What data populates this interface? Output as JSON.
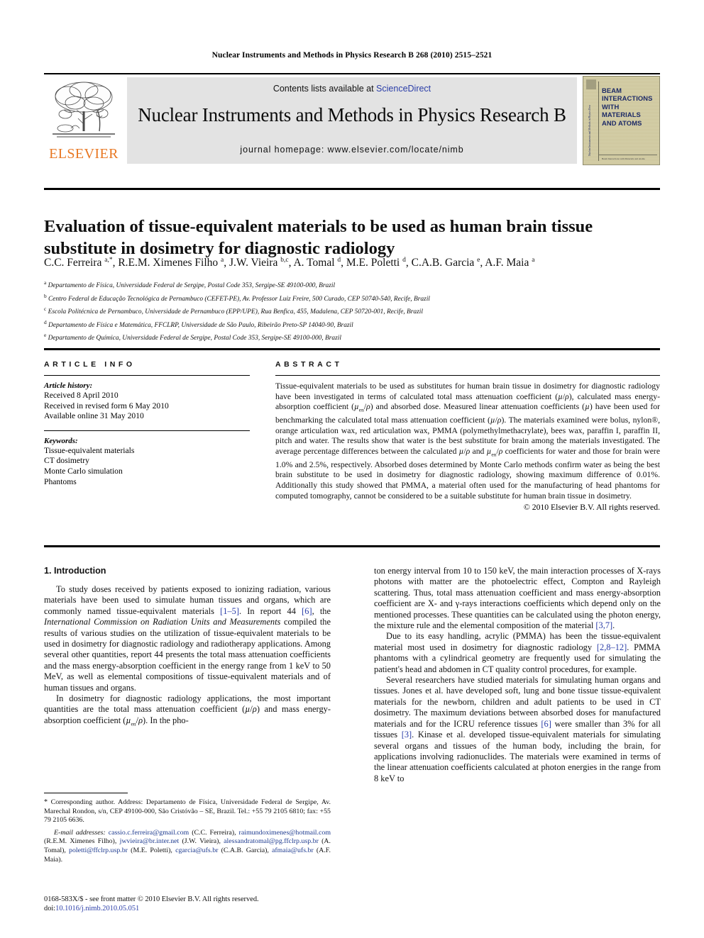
{
  "running_head": "Nuclear Instruments and Methods in Physics Research B 268 (2010) 2515–2521",
  "masthead": {
    "contents_prefix": "Contents lists available at ",
    "contents_link": "ScienceDirect",
    "journal_title": "Nuclear Instruments and Methods in Physics Research B",
    "homepage": "journal homepage: www.elsevier.com/locate/nimb",
    "publisher_logo_text": "ELSEVIER",
    "cover": {
      "title_lines": [
        "BEAM",
        "INTERACTIONS",
        "WITH",
        "MATERIALS",
        "AND ATOMS"
      ],
      "spine_text": "Nuclear Instruments and Methods in Physics Research B",
      "foot_text": "Beam Interactions with Materials and Atoms"
    }
  },
  "article": {
    "title": "Evaluation of tissue-equivalent materials to be used as human brain tissue substitute in dosimetry for diagnostic radiology",
    "authors_html": "C.C. Ferreira <sup>a,*</sup>, R.E.M. Ximenes Filho <sup>a</sup>, J.W. Vieira <sup>b,c</sup>, A. Tomal <sup>d</sup>, M.E. Poletti <sup>d</sup>, C.A.B. Garcia <sup>e</sup>, A.F. Maia <sup>a</sup>",
    "affiliations": [
      {
        "mark": "a",
        "text": "Departamento de Física, Universidade Federal de Sergipe, Postal Code 353, Sergipe-SE 49100-000, Brazil"
      },
      {
        "mark": "b",
        "text": "Centro Federal de Educação Tecnológica de Pernambuco (CEFET-PE), Av. Professor Luiz Freire, 500 Curado, CEP 50740-540, Recife, Brazil"
      },
      {
        "mark": "c",
        "text": "Escola Politécnica de Pernambuco, Universidade de Pernambuco (EPP/UPE), Rua Benfica, 455, Madalena, CEP 50720-001, Recife, Brazil"
      },
      {
        "mark": "d",
        "text": "Departamento de Física e Matemática, FFCLRP, Universidade de São Paulo, Ribeirão Preto-SP 14040-90, Brazil"
      },
      {
        "mark": "e",
        "text": "Departamento de Química, Universidade Federal de Sergipe, Postal Code 353, Sergipe-SE 49100-000, Brazil"
      }
    ]
  },
  "article_info": {
    "label": "ARTICLE INFO",
    "history_heading": "Article history:",
    "history": [
      "Received 8 April 2010",
      "Received in revised form 6 May 2010",
      "Available online 31 May 2010"
    ],
    "keywords_heading": "Keywords:",
    "keywords": [
      "Tissue-equivalent materials",
      "CT dosimetry",
      "Monte Carlo simulation",
      "Phantoms"
    ]
  },
  "abstract": {
    "label": "ABSTRACT",
    "html": "Tissue-equivalent materials to be used as substitutes for human brain tissue in dosimetry for diagnostic radiology have been investigated in terms of calculated total mass attenuation coefficient (<span class=\"ital\">µ</span>/<span class=\"ital\">ρ</span>), calculated mass energy-absorption coefficient (<span class=\"ital\">µ</span><sub>en</sub>/<span class=\"ital\">ρ</span>) and absorbed dose. Measured linear attenuation coefficients (<span class=\"ital\">µ</span>) have been used for benchmarking the calculated total mass attenuation coefficient (<span class=\"ital\">µ</span>/<span class=\"ital\">ρ</span>). The materials examined were bolus, nylon®, orange articulation wax, red articulation wax, PMMA (polymethylmethacrylate), bees wax, paraffin I, paraffin II, pitch and water. The results show that water is the best substitute for brain among the materials investigated. The average percentage differences between the calculated <span class=\"ital\">µ</span>/<span class=\"ital\">ρ</span> and <span class=\"ital\">µ</span><sub>en</sub>/<span class=\"ital\">ρ</span> coefficients for water and those for brain were 1.0% and 2.5%, respectively. Absorbed doses determined by Monte Carlo methods confirm water as being the best brain substitute to be used in dosimetry for diagnostic radiology, showing maximum difference of 0.01%. Additionally this study showed that PMMA, a material often used for the manufacturing of head phantoms for computed tomography, cannot be considered to be a suitable substitute for human brain tissue in dosimetry.",
    "copyright": "© 2010 Elsevier B.V. All rights reserved."
  },
  "body": {
    "section_heading": "1. Introduction",
    "left_paragraphs_html": [
      "To study doses received by patients exposed to ionizing radiation, various materials have been used to simulate human tissues and organs, which are commonly named tissue-equivalent materials <span class=\"ref\">[1–5]</span>. In report 44 <span class=\"ref\">[6]</span>, the <span class=\"ital\">International Commission on Radiation Units and Measurements</span> compiled the results of various studies on the utilization of tissue-equivalent materials to be used in dosimetry for diagnostic radiology and radiotherapy applications. Among several other quantities, report 44 presents the total mass attenuation coefficients and the mass energy-absorption coefficient in the energy range from 1 keV to 50 MeV, as well as elemental compositions of tissue-equivalent materials and of human tissues and organs.",
      "In dosimetry for diagnostic radiology applications, the most important quantities are the total mass attenuation coefficient (<span class=\"ital\">µ</span>/<span class=\"ital\">ρ</span>) and mass energy-absorption coefficient (<span class=\"ital\">µ</span><sub>en</sub>/<span class=\"ital\">ρ</span>). In the pho-"
    ],
    "right_paragraphs_html": [
      "ton energy interval from 10 to 150 keV, the main interaction processes of X-rays photons with matter are the photoelectric effect, Compton and Rayleigh scattering. Thus, total mass attenuation coefficient and mass energy-absorption coefficient are X- and γ-rays interactions coefficients which depend only on the mentioned processes. These quantities can be calculated using the photon energy, the mixture rule and the elemental composition of the material <span class=\"ref\">[3,7]</span>.",
      "Due to its easy handling, acrylic (PMMA) has been the tissue-equivalent material most used in dosimetry for diagnostic radiology <span class=\"ref\">[2,8–12]</span>. PMMA phantoms with a cylindrical geometry are frequently used for simulating the patient's head and abdomen in CT quality control procedures, for example.",
      "Several researchers have studied materials for simulating human organs and tissues. Jones et al. have developed soft, lung and bone tissue tissue-equivalent materials for the newborn, children and adult patients to be used in CT dosimetry. The maximum deviations between absorbed doses for manufactured materials and for the ICRU reference tissues <span class=\"ref\">[6]</span> were smaller than 3% for all tissues <span class=\"ref\">[3]</span>. Kinase et al. developed tissue-equivalent materials for simulating several organs and tissues of the human body, including the brain, for applications involving radionuclides. The materials were examined in terms of the linear attenuation coefficients calculated at photon energies in the range from 8 keV to"
    ]
  },
  "footnote": {
    "corresponding_html": "<span class=\"star\">*</span> Corresponding author. Address: Departamento de Física, Universidade Federal de Sergipe, Av. Marechal Rondon, s/n, CEP 49100-000, São Cristóvão – SE, Brazil. Tel.: +55 79 2105 6810; fax: +55 79 2105 6636.",
    "emails_html": "<span class=\"ital\">E-mail addresses:</span> <span class=\"mail\">cassio.c.ferreira@gmail.com</span> (C.C. Ferreira), <span class=\"mail\">raimundoximenes@hotmail.com</span> (R.E.M. Ximenes Filho), <span class=\"mail\">jwvieira@br.inter.net</span> (J.W. Vieira), <span class=\"mail\">alessandratomal@pg.ffclrp.usp.br</span> (A. Tomal), <span class=\"mail\">poletti@ffclrp.usp.br</span> (M.E. Poletti), <span class=\"mail\">cgarcia@ufs.br</span> (C.A.B. Garcia), <span class=\"mail\">afmaia@ufs.br</span> (A.F. Maia)."
  },
  "page_footer": {
    "issn_line_html": "0168-583X/$ - see front matter © 2010 Elsevier B.V. All rights reserved.",
    "doi_prefix": "doi:",
    "doi_link": "10.1016/j.nimb.2010.05.051"
  },
  "colors": {
    "link_blue": "#2b3ea8",
    "elsevier_orange": "#e87722",
    "masthead_gray": "#e3e3e3",
    "cover_tan": "#cfc89b",
    "cover_navy": "#1d2a66"
  }
}
